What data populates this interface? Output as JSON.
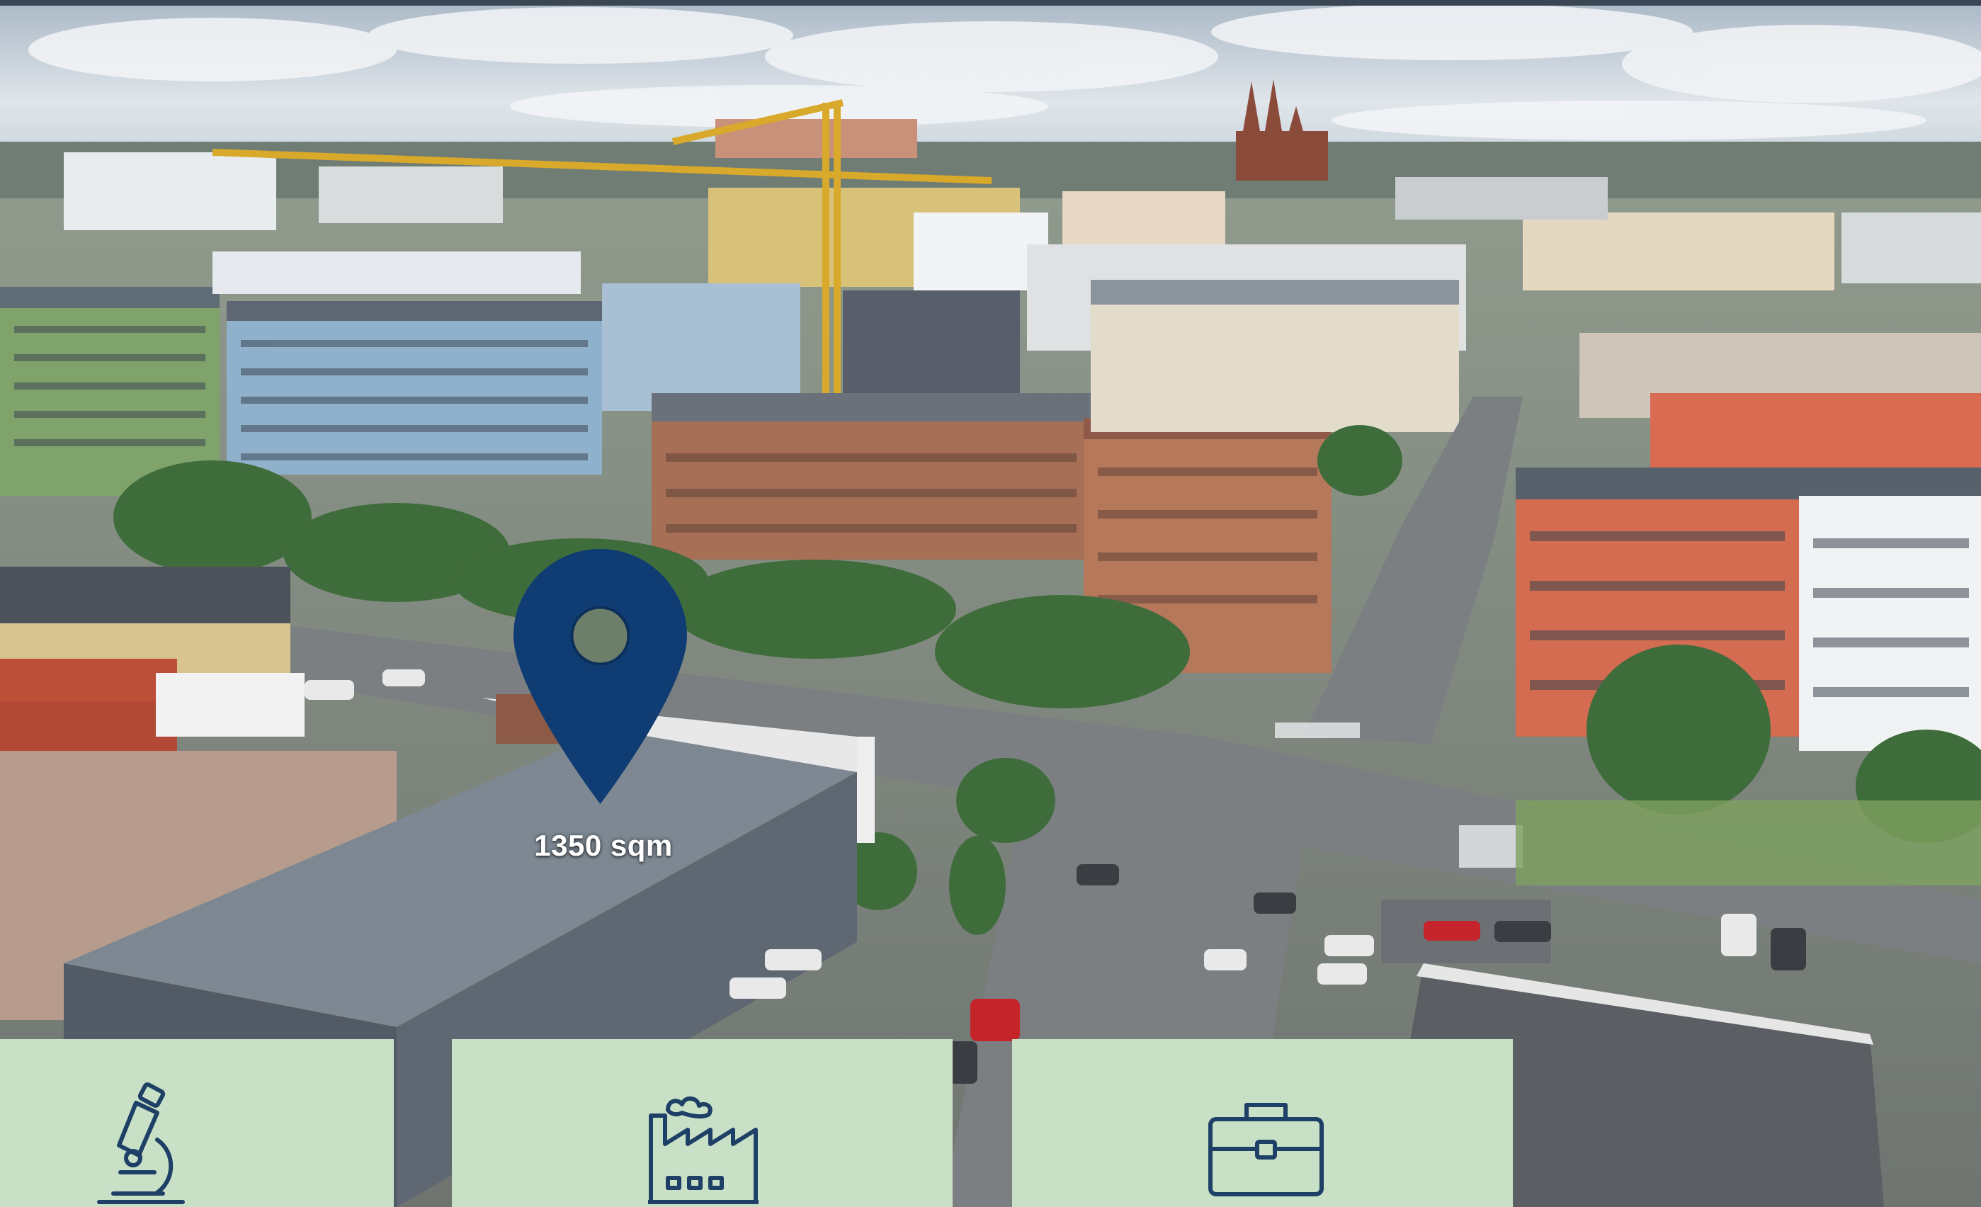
{
  "location_pin": {
    "area_label": "1350 sqm",
    "pin_color": "#0f3d73"
  },
  "cards": [
    {
      "icon": "microscope-icon",
      "background": "#c8e0c6"
    },
    {
      "icon": "factory-icon",
      "background": "#c8e0c6"
    },
    {
      "icon": "briefcase-icon",
      "background": "#c8e0c6"
    }
  ],
  "icon_color": "#1e3f66"
}
